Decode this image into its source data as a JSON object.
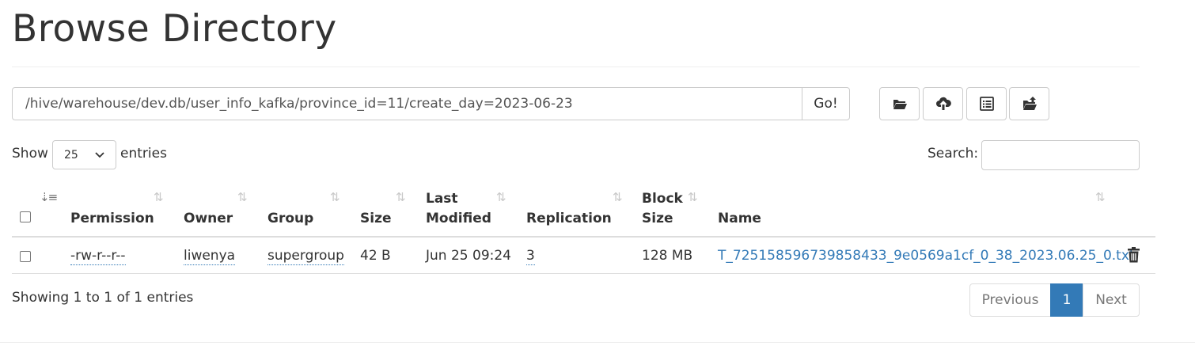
{
  "page_title": "Browse Directory",
  "path_value": "/hive/warehouse/dev.db/user_info_kafka/province_id=11/create_day=2023-06-23",
  "go_label": "Go!",
  "toolbar": [
    "folder-open-icon",
    "cloud-upload-icon",
    "list-icon",
    "folder-upload-icon"
  ],
  "length": {
    "show_label": "Show",
    "selected": "25",
    "entries_label": "entries"
  },
  "search_label": "Search:",
  "columns": {
    "permission": "Permission",
    "owner": "Owner",
    "group": "Group",
    "size": "Size",
    "last_modified_1": "Last",
    "last_modified_2": "Modified",
    "replication": "Replication",
    "block_size_1": "Block",
    "block_size_2": "Size",
    "name": "Name"
  },
  "rows": [
    {
      "permission": "-rw-r--r--",
      "owner": "liwenya",
      "group": "supergroup",
      "size": "42 B",
      "last_modified": "Jun 25 09:24",
      "replication": "3",
      "block_size": "128 MB",
      "name": "T_725158596739858433_9e0569a1cf_0_38_2023.06.25_0.txt"
    }
  ],
  "info": "Showing 1 to 1 of 1 entries",
  "pagination": {
    "previous": "Previous",
    "current": "1",
    "next": "Next"
  },
  "colors": {
    "link": "#337ab7",
    "active_page": "#337ab7",
    "border": "#cccccc"
  }
}
